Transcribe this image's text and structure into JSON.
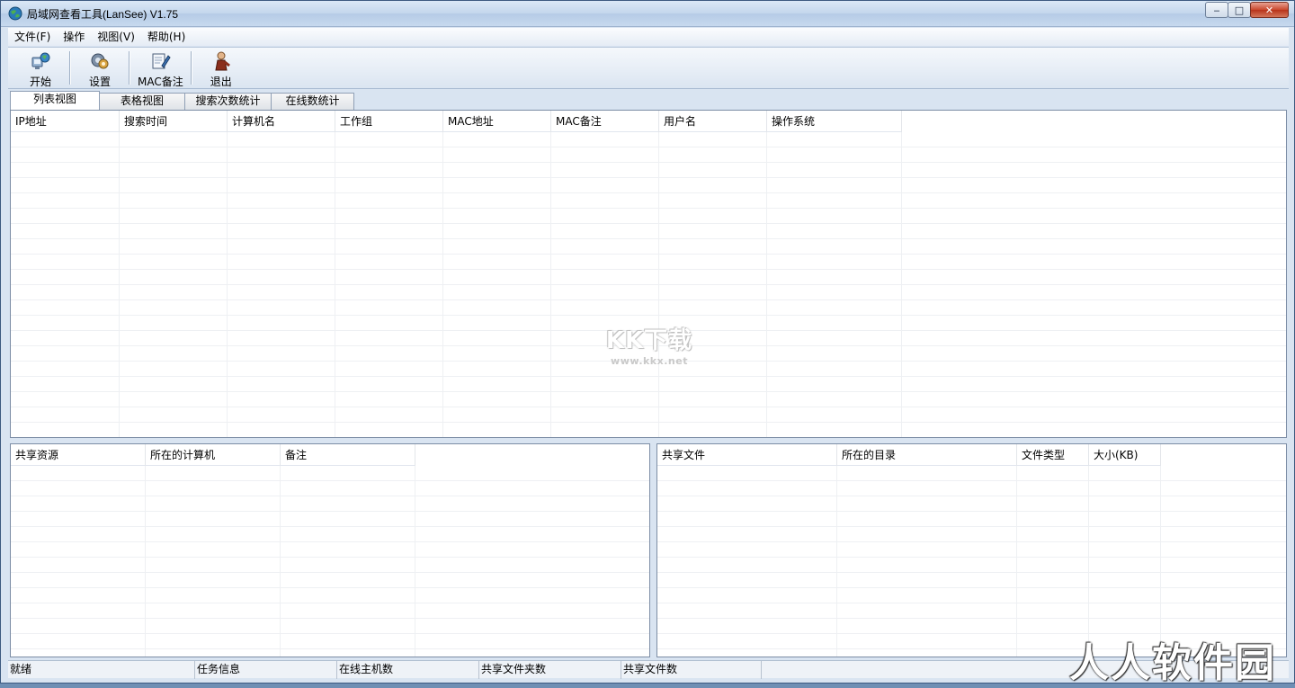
{
  "window": {
    "title": "局域网查看工具(LanSee) V1.75",
    "controls": {
      "minimize": "‒",
      "maximize": "□",
      "close": "✕"
    }
  },
  "menu": [
    {
      "label": "文件(F)"
    },
    {
      "label": "操作"
    },
    {
      "label": "视图(V)"
    },
    {
      "label": "帮助(H)"
    }
  ],
  "toolbar": [
    {
      "label": "开始",
      "icon": "start-icon"
    },
    {
      "label": "设置",
      "icon": "settings-icon"
    },
    {
      "label": "MAC备注",
      "icon": "mac-note-icon"
    },
    {
      "label": "退出",
      "icon": "exit-icon"
    }
  ],
  "tabs": [
    {
      "label": "列表视图",
      "active": true
    },
    {
      "label": "表格视图",
      "active": false
    },
    {
      "label": "搜索次数统计",
      "active": false
    },
    {
      "label": "在线数统计",
      "active": false
    }
  ],
  "main_grid": {
    "columns": [
      "IP地址",
      "搜索时间",
      "计算机名",
      "工作组",
      "MAC地址",
      "MAC备注",
      "用户名",
      "操作系统"
    ],
    "rows": []
  },
  "shares_grid": {
    "columns": [
      "共享资源",
      "所在的计算机",
      "备注"
    ],
    "rows": []
  },
  "files_grid": {
    "columns": [
      "共享文件",
      "所在的目录",
      "文件类型",
      "大小(KB)"
    ],
    "rows": []
  },
  "watermark": {
    "main": "KK下载",
    "sub": "www.kkx.net"
  },
  "corner_logo": "人人软件园",
  "statusbar": [
    {
      "label": "就绪"
    },
    {
      "label": "任务信息"
    },
    {
      "label": "在线主机数"
    },
    {
      "label": "共享文件夹数"
    },
    {
      "label": "共享文件数"
    }
  ]
}
